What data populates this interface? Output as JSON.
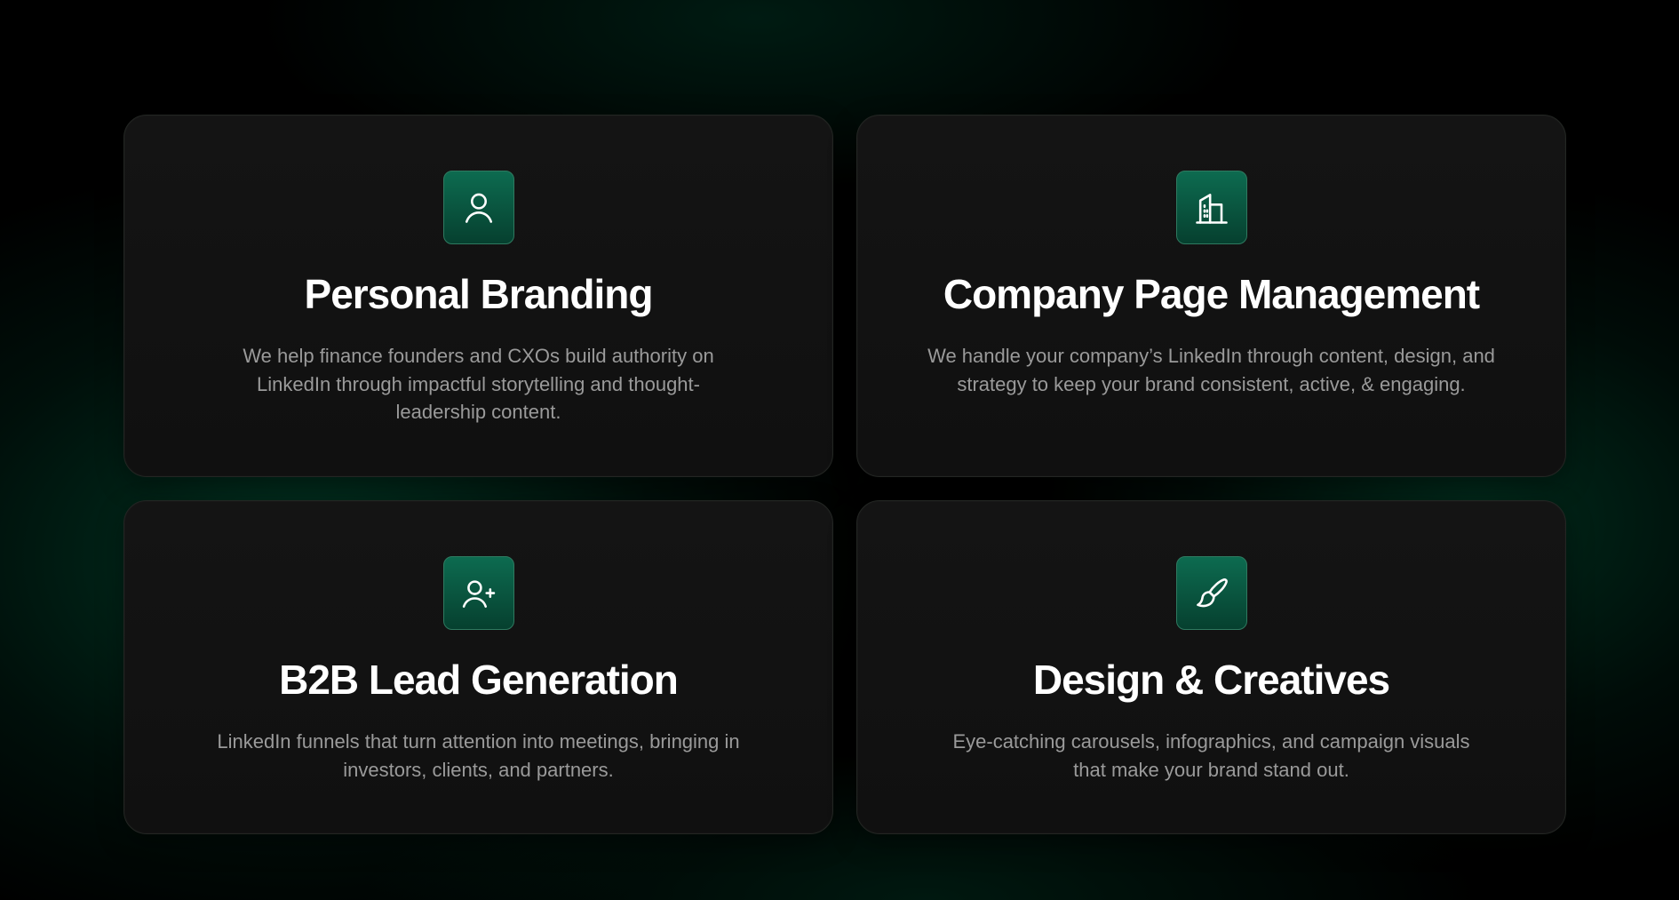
{
  "colors": {
    "background": "#000000",
    "glow_green": "#005f3e",
    "card_bg": "#121212",
    "card_border": "#232623",
    "icon_bg_top": "#0d6b50",
    "icon_bg_bottom": "#06402f",
    "title": "#ffffff",
    "description": "#9a9a9a"
  },
  "services": [
    {
      "icon": "user-icon",
      "title": "Personal Branding",
      "description": "We help finance founders and CXOs build authority on LinkedIn through impactful storytelling and thought-leadership content."
    },
    {
      "icon": "building-icon",
      "title": "Company Page Management",
      "description": "We handle your company’s LinkedIn through content, design, and strategy to keep your brand consistent, active, & engaging."
    },
    {
      "icon": "user-plus-icon",
      "title": "B2B Lead Generation",
      "description": "LinkedIn funnels that turn attention into meetings, bringing in investors, clients, and partners."
    },
    {
      "icon": "paintbrush-icon",
      "title": "Design & Creatives",
      "description": "Eye-catching carousels, infographics, and campaign visuals that make your brand stand out."
    }
  ]
}
